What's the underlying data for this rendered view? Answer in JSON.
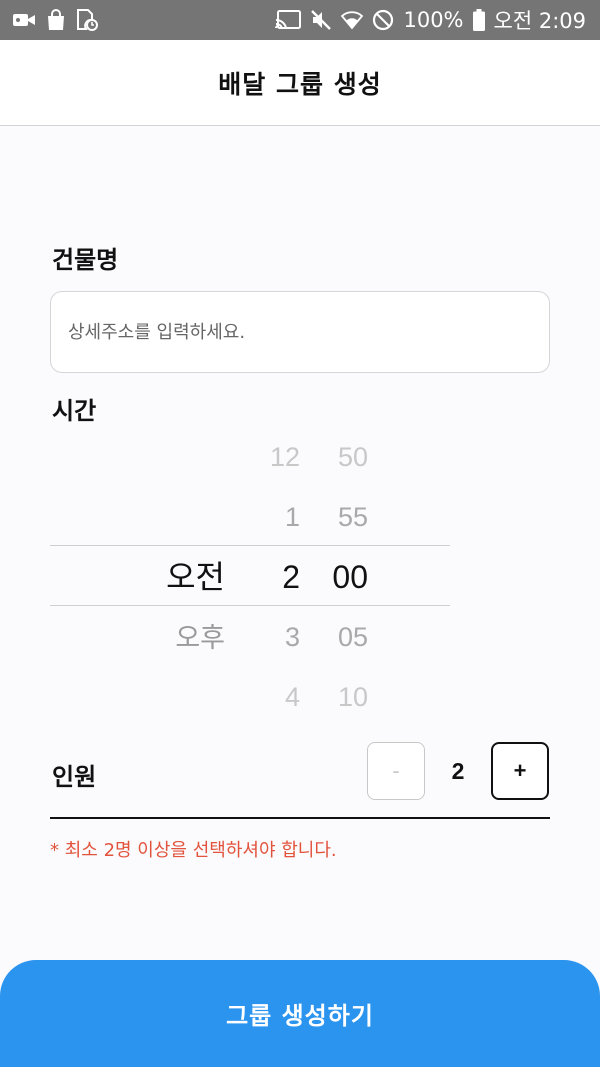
{
  "status_bar": {
    "battery": "100%",
    "time": "오전 2:09",
    "icons": [
      "video-camera-icon",
      "shopping-bag-icon",
      "clock-file-icon",
      "cast-icon",
      "mute-icon",
      "wifi-icon",
      "do-not-disturb-icon",
      "battery-icon"
    ]
  },
  "header": {
    "title": "배달 그룹 생성"
  },
  "building": {
    "label": "건물명",
    "placeholder": "상세주소를 입력하세요.",
    "value": ""
  },
  "time": {
    "label": "시간",
    "ampm": {
      "selected": "오전",
      "below": "오후"
    },
    "hours": {
      "above2": "12",
      "above1": "1",
      "selected": "2",
      "below1": "3",
      "below2": "4"
    },
    "minutes": {
      "above2": "50",
      "above1": "55",
      "selected": "00",
      "below1": "05",
      "below2": "10"
    }
  },
  "people": {
    "label": "인원",
    "minus_label": "-",
    "count": "2",
    "plus_label": "+",
    "warning": "* 최소 2명 이상을 선택하셔야 합니다."
  },
  "submit": {
    "label": "그룹 생성하기"
  },
  "colors": {
    "accent": "#2b94ef",
    "warning": "#e2533c",
    "status_bar": "#757575"
  }
}
